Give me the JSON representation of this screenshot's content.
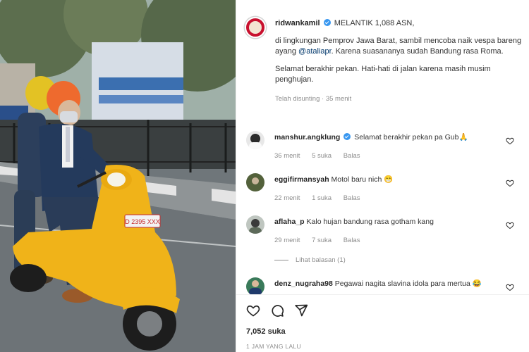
{
  "post": {
    "username": "ridwankamil",
    "caption_title": "MELANTIK 1,088 ASN,",
    "caption_p1_before": "di lingkungan Pemprov Jawa Barat, sambil mencoba naik vespa bareng ayang ",
    "caption_mention": "@ataliapr",
    "caption_p1_after": ". Karena suasananya sudah Bandung rasa Roma.",
    "caption_p2": "Selamat berakhir pekan. Hati-hati di jalan karena masih musim penghujan.",
    "edited_meta": "Telah disunting · 35 menit",
    "likes": "7,052 suka",
    "time_ago": "1 JAM YANG LALU",
    "scooter_plate": "D 2395 XXX"
  },
  "comments": [
    {
      "username": "manshur.angklung",
      "verified": true,
      "text": "Selamat berakhir pekan pa Gub",
      "emoji": "🙏",
      "time": "36 menit",
      "likes": "5 suka",
      "reply": "Balas"
    },
    {
      "username": "eggifirmansyah",
      "verified": false,
      "text": "Motol baru nich",
      "emoji": "😁",
      "time": "22 menit",
      "likes": "1 suka",
      "reply": "Balas"
    },
    {
      "username": "aflaha_p",
      "verified": false,
      "text": "Kalo hujan bandung rasa gotham kang",
      "emoji": "",
      "time": "29 menit",
      "likes": "7 suka",
      "reply": "Balas"
    },
    {
      "username": "denz_nugraha98",
      "verified": false,
      "text": "Pegawai nagita slavina idola para mertua",
      "emoji": "😂",
      "time": "",
      "likes": "",
      "reply": ""
    }
  ],
  "view_replies": "Lihat balasan (1)",
  "icons": [
    "heart-icon",
    "comment-icon",
    "share-icon"
  ]
}
